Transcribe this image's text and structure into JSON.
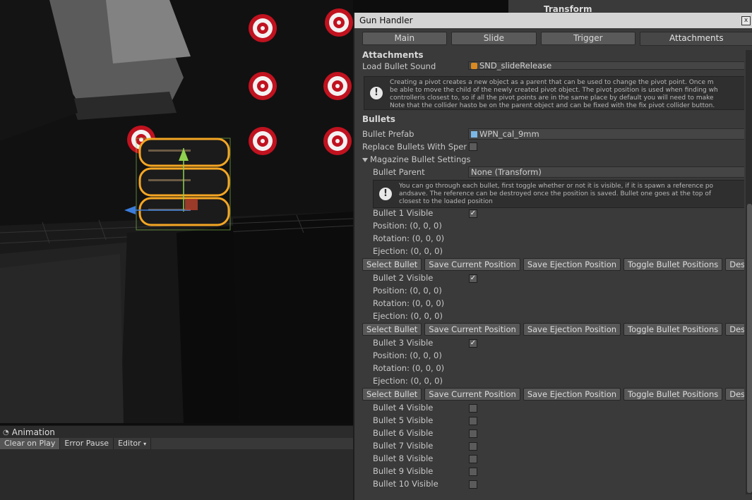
{
  "window": {
    "title": "Gun Handler",
    "close_glyph": "x"
  },
  "topstrip": {
    "label": "Transform"
  },
  "tabs": [
    {
      "label": "Main"
    },
    {
      "label": "Slide"
    },
    {
      "label": "Trigger"
    },
    {
      "label": "Attachments"
    }
  ],
  "attachments": {
    "header": "Attachments",
    "load_sound_label": "Load Bullet Sound",
    "load_sound_value": "SND_slideRelease",
    "help1": "Creating a pivot creates a new object as a parent that can be used to change the pivot point. Once m\nbe able to move the child of the newly created pivot object. The pivot position is used when finding wh\ncontrolleris closest to, so if all the pivot points are in the same place by default you will need to make\nNote that the collider hasto be on the parent object and can be fixed with the fix pivot collider button."
  },
  "bullets": {
    "header": "Bullets",
    "prefab_label": "Bullet Prefab",
    "prefab_value": "WPN_cal_9mm",
    "replace_label": "Replace Bullets With Sper",
    "magazine_label": "Magazine Bullet Settings",
    "parent_label": "Bullet Parent",
    "parent_value": "None (Transform)",
    "help2": "You can go through each bullet, first toggle whether or not it is visible, if it is spawn a reference po\nandsave. The reference can be destroyed once the position is saved. Bullet one goes at the top of\nclosest to the loaded position",
    "position_label": "Position: (0, 0, 0)",
    "rotation_label": "Rotation: (0, 0, 0)",
    "ejection_label": "Ejection: (0, 0, 0)",
    "buttons": {
      "select": "Select Bullet",
      "save_current": "Save Current Position",
      "save_ejection": "Save Ejection Position",
      "toggle": "Toggle Bullet Positions",
      "destroy": "Des"
    },
    "items": [
      {
        "label": "Bullet 1 Visible",
        "checked": true
      },
      {
        "label": "Bullet 2 Visible",
        "checked": true
      },
      {
        "label": "Bullet 3 Visible",
        "checked": true
      },
      {
        "label": "Bullet 4 Visible",
        "checked": false
      },
      {
        "label": "Bullet 5 Visible",
        "checked": false
      },
      {
        "label": "Bullet 6 Visible",
        "checked": false
      },
      {
        "label": "Bullet 7 Visible",
        "checked": false
      },
      {
        "label": "Bullet 8 Visible",
        "checked": false
      },
      {
        "label": "Bullet 9 Visible",
        "checked": false
      },
      {
        "label": "Bullet 10 Visible",
        "checked": false
      }
    ]
  },
  "console": {
    "title": "Animation",
    "clear_on_play": "Clear on Play",
    "error_pause": "Error Pause",
    "editor": "Editor"
  },
  "colors": {
    "target_red": "#c1121f",
    "selection_orange": "#f5a623",
    "gizmo_green": "#8fd14f",
    "gizmo_blue": "#3b7ddd"
  }
}
